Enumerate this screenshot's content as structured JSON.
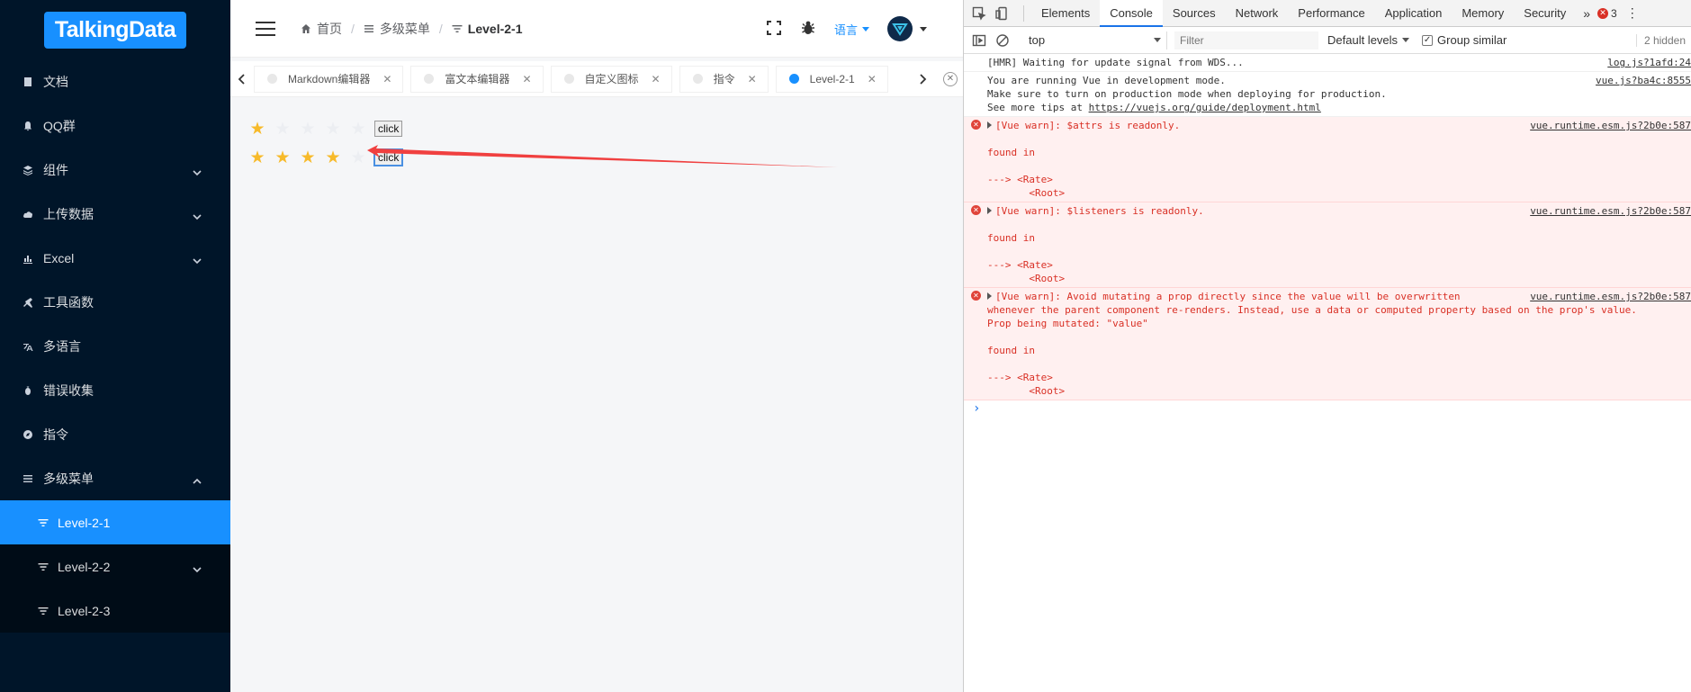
{
  "sidebar": {
    "logo": "TalkingData",
    "items": [
      {
        "label": "文档",
        "icon": "book-icon"
      },
      {
        "label": "QQ群",
        "icon": "bell-icon"
      },
      {
        "label": "组件",
        "icon": "layers-icon",
        "expandable": true
      },
      {
        "label": "上传数据",
        "icon": "cloud-upload-icon",
        "expandable": true
      },
      {
        "label": "Excel",
        "icon": "bar-chart-icon",
        "expandable": true
      },
      {
        "label": "工具函数",
        "icon": "wrench-icon"
      },
      {
        "label": "多语言",
        "icon": "language-icon"
      },
      {
        "label": "错误收集",
        "icon": "bug-icon"
      },
      {
        "label": "指令",
        "icon": "compass-icon"
      },
      {
        "label": "多级菜单",
        "icon": "menu-icon",
        "expanded": true
      }
    ],
    "submenu": [
      {
        "label": "Level-2-1",
        "active": true
      },
      {
        "label": "Level-2-2",
        "expandable": true
      },
      {
        "label": "Level-2-3"
      }
    ]
  },
  "navbar": {
    "breadcrumb": [
      "首页",
      "多级菜单",
      "Level-2-1"
    ],
    "lang_label": "语言"
  },
  "tabs": [
    {
      "label": "Markdown编辑器",
      "active": false
    },
    {
      "label": "富文本编辑器",
      "active": false
    },
    {
      "label": "自定义图标",
      "active": false
    },
    {
      "label": "指令",
      "active": false
    },
    {
      "label": "Level-2-1",
      "active": true
    }
  ],
  "content": {
    "rates": [
      {
        "value": 1,
        "max": 5,
        "button": "click"
      },
      {
        "value": 4,
        "max": 5,
        "button": "click"
      }
    ],
    "colors": {
      "star_on": "#f7ba2a",
      "star_off": "#eceef2",
      "arrow": "#f04040"
    }
  },
  "devtools": {
    "tabs": [
      "Elements",
      "Console",
      "Sources",
      "Network",
      "Performance",
      "Application",
      "Memory",
      "Security"
    ],
    "active_tab": "Console",
    "error_count": "3",
    "context": "top",
    "filter_placeholder": "Filter",
    "levels": "Default levels",
    "group_similar": "Group similar",
    "hidden": "2 hidden",
    "messages": [
      {
        "type": "log",
        "text": "[HMR] Waiting for update signal from WDS...",
        "src": "log.js?1afd:24"
      },
      {
        "type": "log",
        "text": "You are running Vue in development mode.\nMake sure to turn on production mode when deploying for production.\nSee more tips at ",
        "link": "https://vuejs.org/guide/deployment.html",
        "src": "vue.js?ba4c:8555"
      },
      {
        "type": "err",
        "text": "[Vue warn]: $attrs is readonly.\n\nfound in\n\n---> <Rate>\n       <Root>",
        "src": "vue.runtime.esm.js?2b0e:587"
      },
      {
        "type": "err",
        "text": "[Vue warn]: $listeners is readonly.\n\nfound in\n\n---> <Rate>\n       <Root>",
        "src": "vue.runtime.esm.js?2b0e:587"
      },
      {
        "type": "err",
        "text": "[Vue warn]: Avoid mutating a prop directly since the value will be overwritten\nwhenever the parent component re-renders. Instead, use a data or computed property based on the prop's value.\nProp being mutated: \"value\"\n\nfound in\n\n---> <Rate>\n       <Root>",
        "src": "vue.runtime.esm.js?2b0e:587"
      }
    ]
  }
}
